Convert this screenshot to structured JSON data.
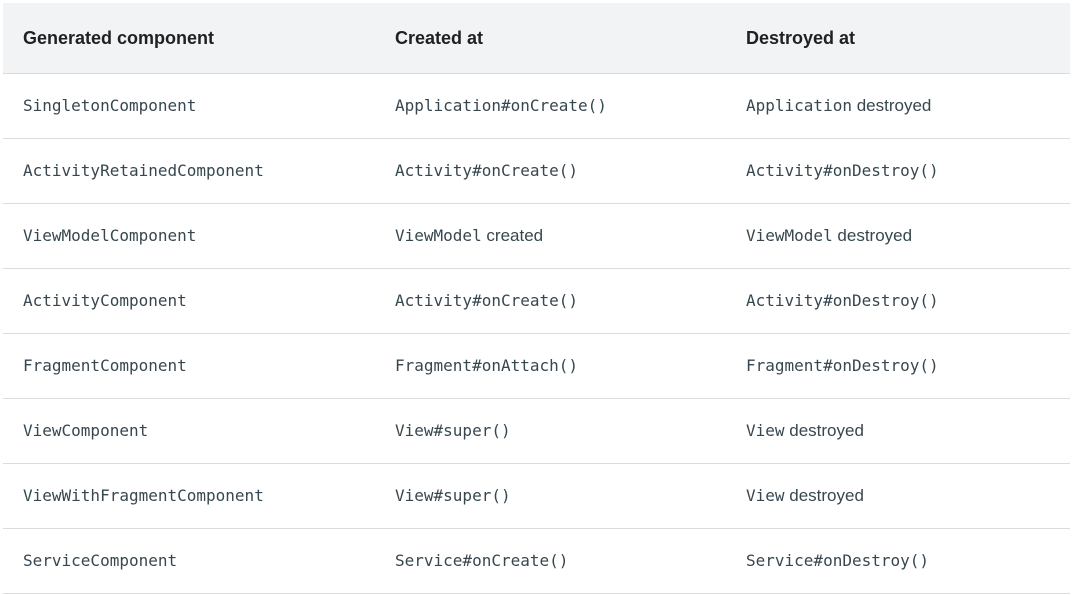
{
  "table": {
    "headers": [
      "Generated component",
      "Created at",
      "Destroyed at"
    ],
    "rows": [
      {
        "component": "SingletonComponent",
        "created": {
          "code": "Application#onCreate()",
          "text": ""
        },
        "destroyed": {
          "code": "Application",
          "text": " destroyed"
        }
      },
      {
        "component": "ActivityRetainedComponent",
        "created": {
          "code": "Activity#onCreate()",
          "text": ""
        },
        "destroyed": {
          "code": "Activity#onDestroy()",
          "text": ""
        }
      },
      {
        "component": "ViewModelComponent",
        "created": {
          "code": "ViewModel",
          "text": " created"
        },
        "destroyed": {
          "code": "ViewModel",
          "text": " destroyed"
        }
      },
      {
        "component": "ActivityComponent",
        "created": {
          "code": "Activity#onCreate()",
          "text": ""
        },
        "destroyed": {
          "code": "Activity#onDestroy()",
          "text": ""
        }
      },
      {
        "component": "FragmentComponent",
        "created": {
          "code": "Fragment#onAttach()",
          "text": ""
        },
        "destroyed": {
          "code": "Fragment#onDestroy()",
          "text": ""
        }
      },
      {
        "component": "ViewComponent",
        "created": {
          "code": "View#super()",
          "text": ""
        },
        "destroyed": {
          "code": "View",
          "text": " destroyed"
        }
      },
      {
        "component": "ViewWithFragmentComponent",
        "created": {
          "code": "View#super()",
          "text": ""
        },
        "destroyed": {
          "code": "View",
          "text": " destroyed"
        }
      },
      {
        "component": "ServiceComponent",
        "created": {
          "code": "Service#onCreate()",
          "text": ""
        },
        "destroyed": {
          "code": "Service#onDestroy()",
          "text": ""
        }
      }
    ]
  }
}
